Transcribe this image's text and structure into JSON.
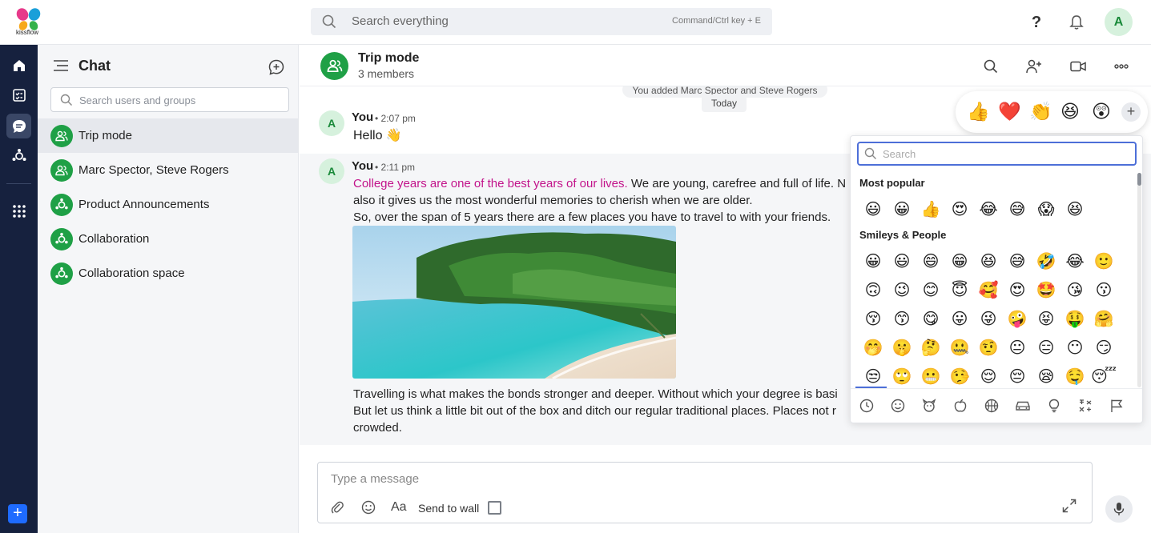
{
  "app": {
    "brand": "kissflow",
    "user_initial": "A"
  },
  "topbar": {
    "search_placeholder": "Search everything",
    "search_hint": "Command/Ctrl key + E"
  },
  "rail": {
    "plus_label": "+"
  },
  "sidebar": {
    "title": "Chat",
    "search_placeholder": "Search users and groups",
    "items": [
      {
        "label": "Trip mode",
        "icon": "group-icon",
        "active": true
      },
      {
        "label": "Marc Spector, Steve Rogers",
        "icon": "group-icon",
        "active": false
      },
      {
        "label": "Product Announcements",
        "icon": "community-icon",
        "active": false
      },
      {
        "label": "Collaboration",
        "icon": "community-icon",
        "active": false
      },
      {
        "label": "Collaboration space",
        "icon": "community-icon",
        "active": false
      }
    ]
  },
  "chat": {
    "title": "Trip mode",
    "members": "3 members",
    "system_message": "You added Marc Spector and Steve Rogers",
    "date_divider": "Today",
    "messages": [
      {
        "avatar": "A",
        "author": "You",
        "time": "• 2:07 pm",
        "text": "Hello 👋"
      },
      {
        "avatar": "A",
        "author": "You",
        "time": "• 2:11 pm",
        "highlight": "College years are one of the best years of our lives.",
        "line1_rest": " We are young, carefree and full of life. N",
        "line2": "also it gives us the most wonderful memories to cherish when we are older.",
        "line3": "So, over the span of 5 years there are a few places you have to travel to with your friends.",
        "line4": "Travelling is what makes the bonds stronger and deeper. Without which your degree is basi",
        "line5": "But let us think a little bit out of the box and ditch our regular traditional places. Places not r",
        "line6": "crowded."
      }
    ]
  },
  "composer": {
    "placeholder": "Type a message",
    "format_label": "Aa",
    "send_to_wall_label": "Send to wall"
  },
  "reactions": {
    "items": [
      "👍",
      "❤️",
      "👏",
      "😆",
      "😲"
    ],
    "add_label": "+"
  },
  "picker": {
    "search_placeholder": "Search",
    "most_popular_label": "Most popular",
    "most_popular": [
      "😃",
      "😀",
      "👍",
      "😍",
      "😂",
      "😅",
      "😱",
      "😆"
    ],
    "smileys_label": "Smileys & People",
    "smileys": [
      [
        "😀",
        "😃",
        "😄",
        "😁",
        "😆",
        "😅",
        "🤣",
        "😂",
        "🙂"
      ],
      [
        "🙃",
        "😉",
        "😊",
        "😇",
        "🥰",
        "😍",
        "🤩",
        "😘",
        "😗"
      ],
      [
        "😚",
        "😙",
        "😋",
        "😛",
        "😜",
        "🤪",
        "😝",
        "🤑",
        "🤗"
      ],
      [
        "🤭",
        "🤫",
        "🤔",
        "🤐",
        "🤨",
        "😐",
        "😑",
        "😶",
        "😏"
      ],
      [
        "😒",
        "🙄",
        "😬",
        "🤥",
        "😌",
        "😔",
        "😪",
        "🤤",
        "😴"
      ]
    ]
  },
  "colors": {
    "accent_green": "#1fa046",
    "rail_bg": "#16213e",
    "highlight_pink": "#c2138a",
    "picker_accent": "#4d6fd8"
  }
}
